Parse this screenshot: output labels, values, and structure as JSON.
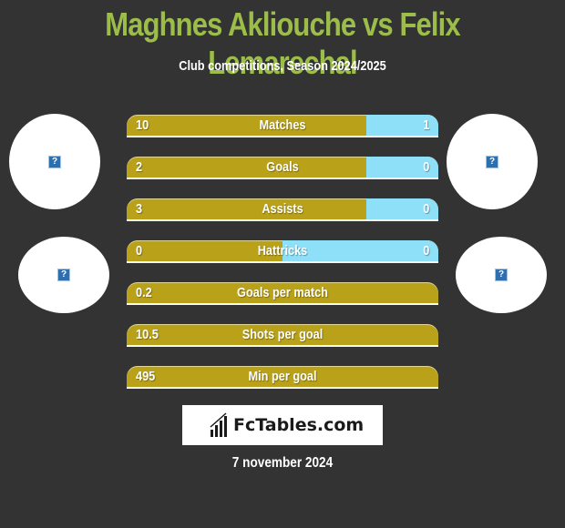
{
  "header": {
    "title": "Maghnes Akliouche vs Felix Lemarechal",
    "subtitle": "Club competitions, Season 2024/2025"
  },
  "colors": {
    "title": "#9cbd4a",
    "left_bar": "#b9a21a",
    "right_bar": "#8ee0f8",
    "background": "#333333"
  },
  "avatars": {
    "player1_icon": "broken-image-icon",
    "player2_icon": "broken-image-icon",
    "club1_icon": "broken-image-icon",
    "club2_icon": "broken-image-icon",
    "placeholder_glyph": "?"
  },
  "stats": [
    {
      "label": "Matches",
      "left": "10",
      "right": "1",
      "right_share": 0.23
    },
    {
      "label": "Goals",
      "left": "2",
      "right": "0",
      "right_share": 0.23
    },
    {
      "label": "Assists",
      "left": "3",
      "right": "0",
      "right_share": 0.23
    },
    {
      "label": "Hattricks",
      "left": "0",
      "right": "0",
      "right_share": 0.5
    },
    {
      "label": "Goals per match",
      "left": "0.2",
      "right": "",
      "right_share": 0
    },
    {
      "label": "Shots per goal",
      "left": "10.5",
      "right": "",
      "right_share": 0
    },
    {
      "label": "Min per goal",
      "left": "495",
      "right": "",
      "right_share": 0
    }
  ],
  "footer": {
    "logo_text": "FcTables.com",
    "date": "7 november 2024"
  }
}
